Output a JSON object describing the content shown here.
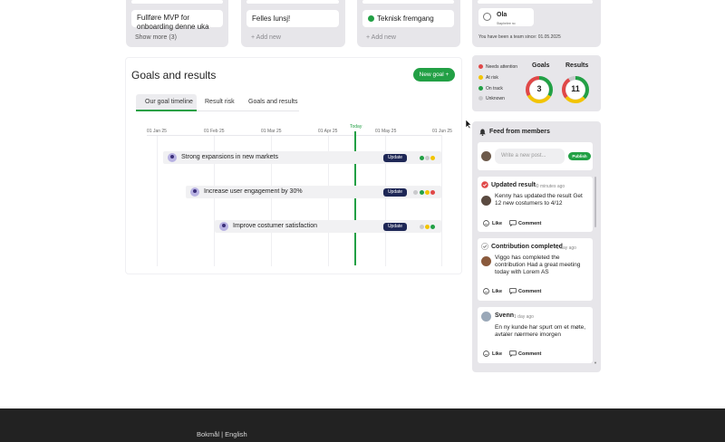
{
  "board": {
    "col1": {
      "card_text": "Fullføre MVP for onboarding denne uka",
      "show_more": "Show more (3)"
    },
    "col2": {
      "card_text": "Felles lunsj!",
      "add_new": "+ Add new"
    },
    "col3": {
      "card_text": "Teknisk fremgang",
      "add_new": "+ Add new",
      "dot_color": "#22a045"
    },
    "team": {
      "user_name": "Ola",
      "user_sub": "Staphelee no",
      "member_since": "You have been a team since: 01.05.2025"
    }
  },
  "goals": {
    "title": "Goals and results",
    "new_goal": "New goal +",
    "tabs": [
      "Our goal timeline",
      "Result risk",
      "Goals and results"
    ],
    "today_label": "Today",
    "months": [
      "01 Jan 25",
      "01 Feb 25",
      "01 Mar 25",
      "01 Apr 25",
      "01 May 25",
      "01 Jun 25"
    ],
    "rows": [
      {
        "label": "Strong expansions in new markets",
        "update": "Update",
        "status": [
          "#22a045",
          "#c9c9cc",
          "#f2c400"
        ]
      },
      {
        "label": "Increase user engagement by 30%",
        "update": "Update",
        "status": [
          "#c9c9cc",
          "#22a045",
          "#f2c400",
          "#e04848"
        ]
      },
      {
        "label": "Improve costumer satisfaction",
        "update": "Update",
        "status": [
          "#c9c9cc",
          "#f2c400",
          "#22a045"
        ]
      }
    ]
  },
  "status_legend": {
    "items": [
      {
        "label": "Needs attention",
        "color": "#e04848"
      },
      {
        "label": "At risk",
        "color": "#f2c400"
      },
      {
        "label": "On track",
        "color": "#22a045"
      },
      {
        "label": "Unknown",
        "color": "#c9c9cc"
      }
    ],
    "goals_label": "Goals",
    "goals_count": "3",
    "results_label": "Results",
    "results_count": "11"
  },
  "feed": {
    "title": "Feed from members",
    "placeholder": "Write a new post...",
    "publish": "Publish",
    "like": "Like",
    "comment": "Comment",
    "posts": [
      {
        "title": "Updated result",
        "time": "40 minutes ago",
        "text": "Kenny has updated the result Get 12 new costumers to 4/12"
      },
      {
        "title": "Contribution completed",
        "time": "1 day ago",
        "text": "Viggo has completed the contribution Had a great meeting today with Lorem AS"
      },
      {
        "title": "Svenn",
        "time": "1 day ago",
        "text": "En ny kunde har spurt om et møte, avtaler nærmere imorgen"
      }
    ]
  },
  "footer": {
    "languages": "Bokmål | English"
  }
}
